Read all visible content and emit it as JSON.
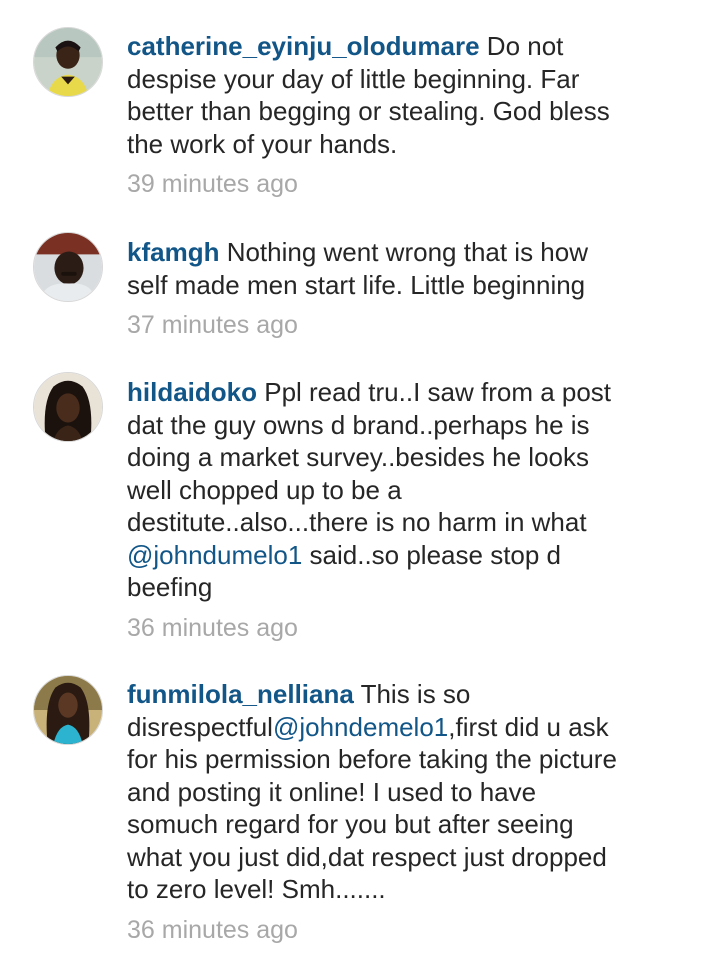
{
  "comments": [
    {
      "username": "catherine_eyinju_olodumare",
      "lines": [
        " Do not",
        "despise your day of little beginning. Far",
        "better than begging or stealing. God bless",
        "the work of your hands."
      ],
      "time": "39 minutes ago"
    },
    {
      "username": "kfamgh",
      "lines": [
        " Nothing went wrong that is how",
        "self made men start life. Little beginning"
      ],
      "time": "37 minutes ago"
    },
    {
      "username": "hildaidoko",
      "lines": [
        " Ppl read tru..I saw from a post",
        "dat the guy owns d brand..perhaps he is",
        "doing a market survey..besides he looks",
        "well chopped up to be a",
        "destitute..also...there is no harm in what"
      ],
      "mention": "@johndumelo1",
      "after_mention": " said..so please stop d",
      "last_line": "beefing",
      "time": "36 minutes ago"
    },
    {
      "username": "funmilola_nelliana",
      "first_line": " This is so",
      "before_mention": "disrespectful",
      "mention": "@johndemelo1",
      "after_mention": ",first did u ask",
      "lines": [
        "for his permission before taking the picture",
        "and posting it online! I used to have",
        "somuch regard for you but after seeing",
        "what you just did,dat respect just dropped",
        "to zero level! Smh......."
      ],
      "time": "36 minutes ago"
    }
  ],
  "colors": {
    "username": "#125688",
    "text": "#262626",
    "timestamp": "#a8a8a8",
    "background": "#ffffff"
  }
}
